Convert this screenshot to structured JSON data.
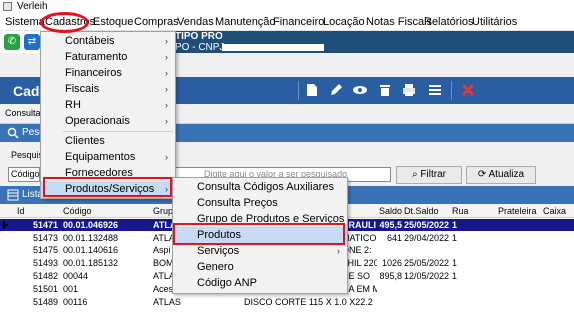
{
  "window": {
    "title": "Verleih"
  },
  "menubar": {
    "items": [
      "Sistema",
      "Cadastros",
      "Estoque",
      "Compras",
      "Vendas",
      "Manutenção",
      "Financeiro",
      "Locação",
      "Notas Fiscais",
      "Relatórios",
      "Utilitários"
    ]
  },
  "company": {
    "name": "TIPO PRO",
    "cnpj_label": "PO - CNPJ :"
  },
  "toolbar": {
    "heading": "Cada"
  },
  "tabs": {
    "label": "Consultar"
  },
  "search": {
    "section_title": "Pesq",
    "label": "Pesquisa",
    "field": "Código",
    "placeholder": "Digite aqui o valor a ser pesquisado",
    "filter_button": "Filtrar",
    "refresh_button": "Atualiza"
  },
  "list": {
    "section_title": "Lista",
    "columns": [
      "Id",
      "Código",
      "Grup",
      "",
      "Saldo",
      "Dt.Saldo",
      "Rua",
      "Prateleira",
      "Caixa"
    ],
    "rows": [
      {
        "id": "51471",
        "codigo": "00.01.046926",
        "grupo": "ATLA",
        "descricao": "DRAULI",
        "saldo": "495,5",
        "dt_saldo": "25/05/2022",
        "rua": "1",
        "selected": true
      },
      {
        "id": "51473",
        "codigo": "00.01.132488",
        "grupo": "ATLA",
        "descricao": "MATICO",
        "saldo": "641",
        "dt_saldo": "29/04/2022",
        "rua": "1",
        "selected": false
      },
      {
        "id": "51475",
        "codigo": "00.01.140616",
        "grupo": "Aspi",
        "descricao": "ONE 2:",
        "saldo": "",
        "dt_saldo": "",
        "rua": "",
        "selected": false
      },
      {
        "id": "51493",
        "codigo": "00.01.185132",
        "grupo": "BOM",
        "descricao": "THIL 220",
        "saldo": "1026",
        "dt_saldo": "25/05/2022",
        "rua": "1",
        "selected": false
      },
      {
        "id": "51482",
        "codigo": "00044",
        "grupo": "ATLA",
        "descricao": "DE SO",
        "saldo": "895,8",
        "dt_saldo": "12/05/2022",
        "rua": "1",
        "selected": false
      },
      {
        "id": "51501",
        "codigo": "001",
        "grupo": "Aces",
        "descricao": "DA EM M",
        "saldo": "",
        "dt_saldo": "",
        "rua": "",
        "selected": false
      },
      {
        "id": "51489",
        "codigo": "00116",
        "grupo": "ATLAS",
        "descricao": "DISCO  CORTE 115 X 1.0 X22.2",
        "saldo": "",
        "dt_saldo": "",
        "rua": "",
        "selected": false
      }
    ]
  },
  "cadastros_menu": {
    "items": [
      "Contábeis",
      "Faturamento",
      "Financeiros",
      "Fiscais",
      "RH",
      "Operacionais",
      "Clientes",
      "Equipamentos",
      "Fornecedores",
      "Produtos/Serviços"
    ]
  },
  "produtos_submenu": {
    "items": [
      "Consulta Códigos Auxiliares",
      "Consulta Preços",
      "Grupo de Produtos e Serviços",
      "Produtos",
      "Serviços",
      "Genero",
      "Código ANP"
    ]
  },
  "colors": {
    "highlight_red": "#e0141e",
    "selected_row": "#16188a",
    "toolbar_blue": "#2a5ea3"
  }
}
